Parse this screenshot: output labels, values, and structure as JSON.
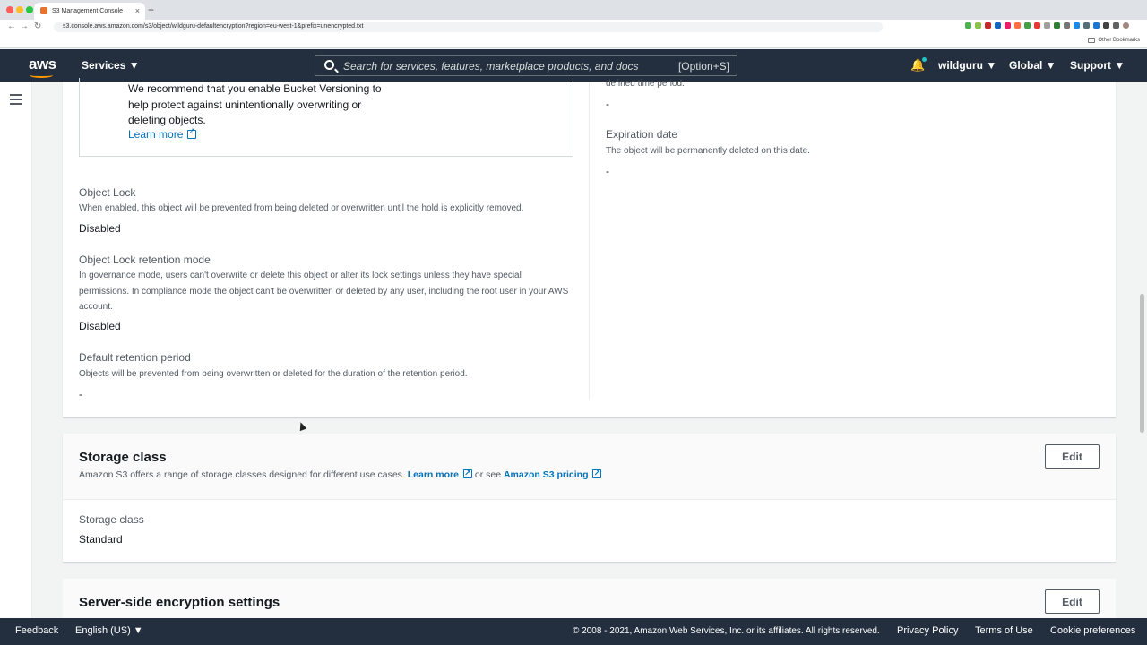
{
  "browser": {
    "tab_title": "S3 Management Console",
    "url": "s3.console.aws.amazon.com/s3/object/wildguru-defaultencryption?region=eu-west-1&prefix=unencrypted.txt",
    "other_bookmarks": "Other Bookmarks"
  },
  "header": {
    "logo": "aws",
    "services": "Services ▼",
    "search_placeholder": "Search for services, features, marketplace products, and docs",
    "search_shortcut": "[Option+S]",
    "user": "wildguru ▼",
    "region": "Global ▼",
    "support": "Support ▼"
  },
  "versioning_box": {
    "text": "We recommend that you enable Bucket Versioning to help protect against unintentionally overwriting or deleting objects.",
    "learn_more": "Learn more"
  },
  "object_lock": {
    "label": "Object Lock",
    "desc": "When enabled, this object will be prevented from being deleted or overwritten until the hold is explicitly removed.",
    "value": "Disabled"
  },
  "retention_mode": {
    "label": "Object Lock retention mode",
    "desc": "In governance mode, users can't overwrite or delete this object or alter its lock settings unless they have special permissions. In compliance mode the object can't be overwritten or deleted by any user, including the root user in your AWS account.",
    "value": "Disabled"
  },
  "retention_period": {
    "label": "Default retention period",
    "desc": "Objects will be prevented from being overwritten or deleted for the duration of the retention period.",
    "value": "-"
  },
  "right_col": {
    "cut_text": "defined time period.",
    "top_value": "-",
    "expiration_label": "Expiration date",
    "expiration_desc": "The object will be permanently deleted on this date.",
    "expiration_value": "-"
  },
  "storage_class": {
    "title": "Storage class",
    "desc_prefix": "Amazon S3 offers a range of storage classes designed for different use cases.",
    "learn_more": "Learn more",
    "or_see": "or see",
    "pricing": "Amazon S3 pricing",
    "edit": "Edit",
    "field_label": "Storage class",
    "field_value": "Standard"
  },
  "encryption": {
    "title": "Server-side encryption settings",
    "edit": "Edit"
  },
  "footer": {
    "feedback": "Feedback",
    "language": "English (US) ▼",
    "copyright": "© 2008 - 2021, Amazon Web Services, Inc. or its affiliates. All rights reserved.",
    "privacy": "Privacy Policy",
    "terms": "Terms of Use",
    "cookies": "Cookie preferences"
  }
}
